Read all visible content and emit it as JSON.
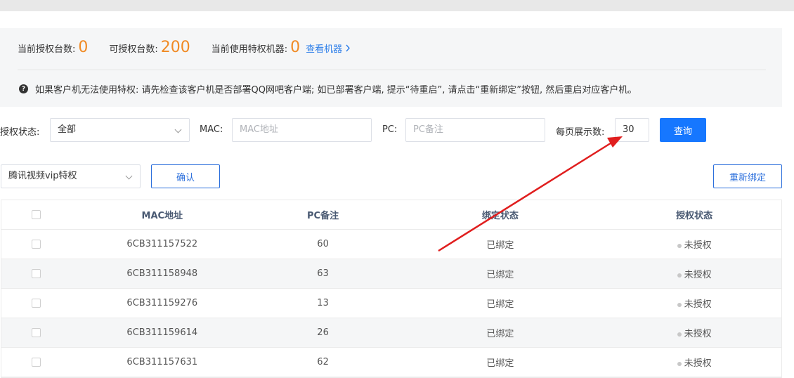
{
  "stats": {
    "current_label": "当前授权台数:",
    "current_value": "0",
    "available_label": "可授权台数:",
    "available_value": "200",
    "inuse_label": "当前使用特权机器:",
    "inuse_value": "0",
    "view_link": "查看机器"
  },
  "notice": {
    "icon": "?",
    "text": "如果客户机无法使用特权: 请先检查该客户机是否部署QQ网吧客户端; 如已部署客户端, 提示“待重启”, 请点击“重新绑定”按钮, 然后重启对应客户机。"
  },
  "filters": {
    "auth_status_label": "授权状态:",
    "auth_status_value": "全部",
    "mac_label": "MAC:",
    "mac_placeholder": "MAC地址",
    "pc_label": "PC:",
    "pc_placeholder": "PC备注",
    "page_size_label": "每页展示数:",
    "page_size_value": "30",
    "query_button": "查询"
  },
  "actions": {
    "privilege_select": "腾讯视频vip特权",
    "confirm_button": "确认",
    "rebind_button": "重新绑定"
  },
  "table": {
    "headers": {
      "mac": "MAC地址",
      "pc": "PC备注",
      "bind": "绑定状态",
      "auth": "授权状态"
    },
    "rows": [
      {
        "mac": "6CB311157522",
        "pc": "60",
        "bind": "已绑定",
        "auth": "未授权"
      },
      {
        "mac": "6CB311158948",
        "pc": "63",
        "bind": "已绑定",
        "auth": "未授权"
      },
      {
        "mac": "6CB311159276",
        "pc": "13",
        "bind": "已绑定",
        "auth": "未授权"
      },
      {
        "mac": "6CB311159614",
        "pc": "26",
        "bind": "已绑定",
        "auth": "未授权"
      },
      {
        "mac": "6CB311157631",
        "pc": "62",
        "bind": "已绑定",
        "auth": "未授权"
      }
    ]
  },
  "colors": {
    "accent_orange": "#f08a24",
    "primary_blue": "#1677ff",
    "annotation_red": "#e01e1e"
  }
}
